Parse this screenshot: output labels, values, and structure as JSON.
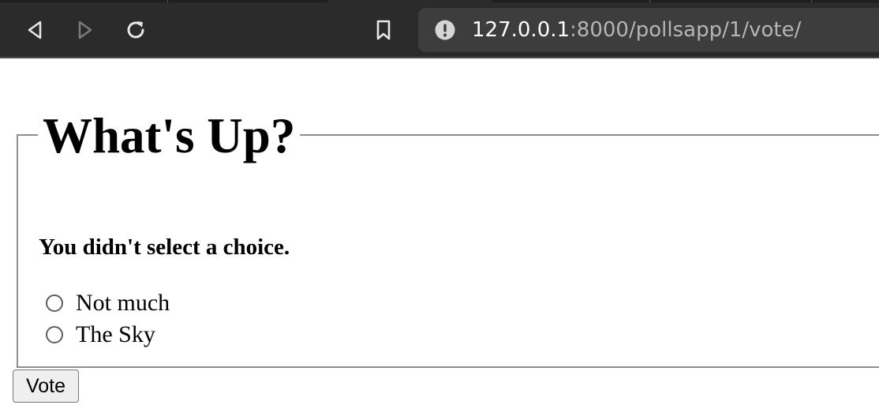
{
  "browser": {
    "url_host": "127.0.0.1",
    "url_rest": ":8000/pollsapp/1/vote/",
    "icons": {
      "back": "back-arrow-icon",
      "forward": "forward-arrow-icon",
      "reload": "reload-icon",
      "bookmark": "bookmark-icon",
      "site_info": "info-icon"
    }
  },
  "poll": {
    "question": "What's Up?",
    "error_message": "You didn't select a choice.",
    "choices": [
      {
        "label": "Not much",
        "selected": false
      },
      {
        "label": "The Sky",
        "selected": false
      }
    ],
    "submit_label": "Vote"
  },
  "colors": {
    "chrome_background": "#2b2b2b",
    "url_bar_background": "#3d3d3d",
    "url_host_text": "#ffffff",
    "url_path_text": "#b5b5b5",
    "fieldset_border": "#8f8f8f",
    "button_background": "#efefef"
  }
}
